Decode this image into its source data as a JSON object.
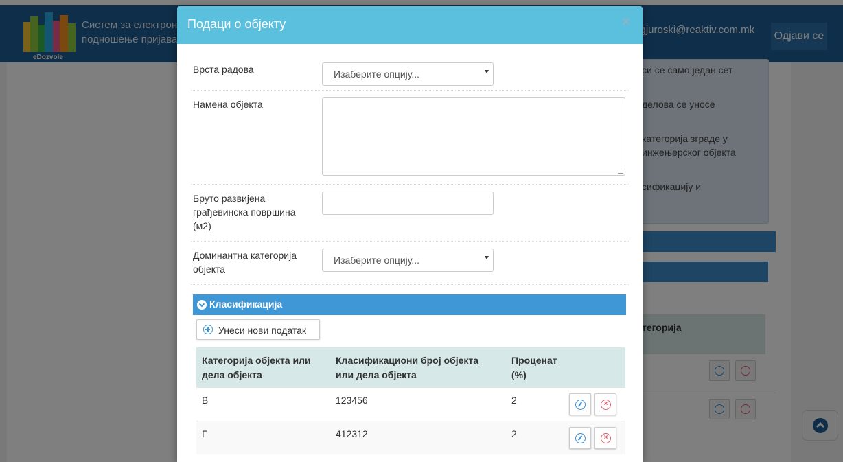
{
  "background": {
    "brand": {
      "logo_text": "eDozvole",
      "line1": "Систем за електрон",
      "line2": "подношење пријава"
    },
    "user_email": "n.gjuroski@reaktiv.com.mk",
    "logout_label": "Одјави се",
    "info_lines": [
      "си се само један сет",
      "делова се уносе",
      "категорија зграде у",
      "инжењерског објекта",
      "сификацију и"
    ],
    "table_header": "тегорија"
  },
  "modal": {
    "title": "Подаци о објекту",
    "close_symbol": "×",
    "fields": {
      "work_type": {
        "label": "Врста радова",
        "value": "Изаберите опцију..."
      },
      "purpose": {
        "label": "Намена објекта",
        "value": ""
      },
      "gross_area": {
        "label": "Бруто развијена грађевинска површина (м2)",
        "value": ""
      },
      "dominant_category": {
        "label": "Доминантна категорија објекта",
        "value": "Изаберите опцију..."
      }
    },
    "section": {
      "title": "Класификација",
      "add_button_label": "Унеси нови податак",
      "table": {
        "headers": [
          "Категорија објекта или дела објекта",
          "Класификациони број објекта или дела објекта",
          "Проценат (%)"
        ],
        "rows": [
          {
            "category": "В",
            "class_number": "123456",
            "percent": "2"
          },
          {
            "category": "Г",
            "class_number": "412312",
            "percent": "2"
          }
        ]
      }
    }
  },
  "icons": [
    "logo-icon",
    "close-icon",
    "chevron-down-icon",
    "add-circle-icon",
    "edit-icon",
    "delete-icon",
    "scroll-top-icon"
  ],
  "colors": {
    "header_bg": "#1f5c92",
    "modal_header": "#5bc0de",
    "section_bar": "#3f97d6",
    "table_head": "#d7e8e8"
  }
}
